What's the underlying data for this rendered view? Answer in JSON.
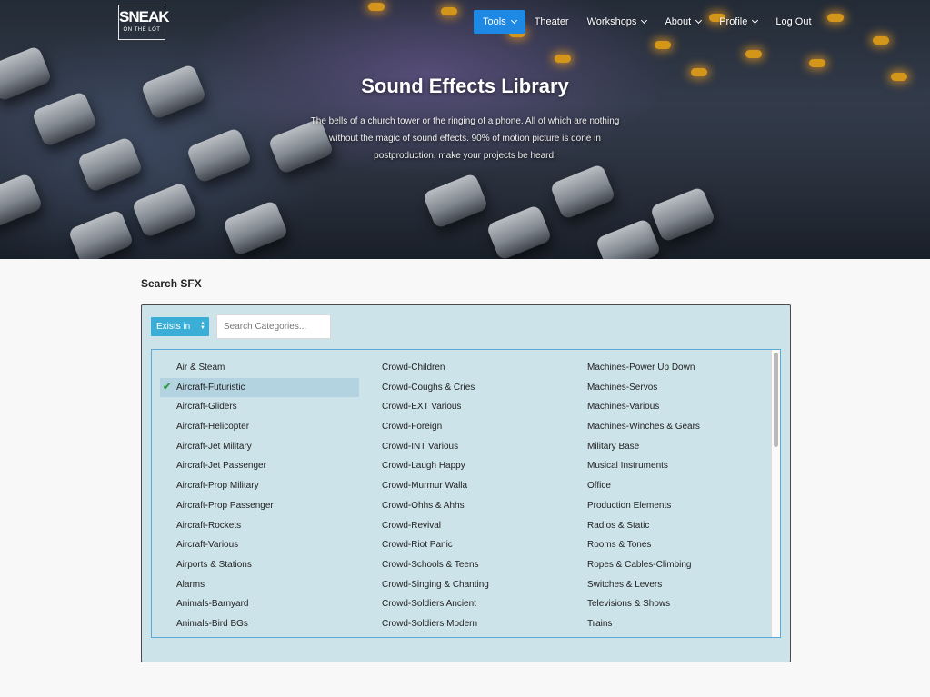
{
  "nav": {
    "logo_line1": "SNEAK",
    "logo_line2": "ON THE LOT",
    "items": [
      {
        "label": "Tools",
        "dropdown": true,
        "active": true
      },
      {
        "label": "Theater",
        "dropdown": false,
        "active": false
      },
      {
        "label": "Workshops",
        "dropdown": true,
        "active": false
      },
      {
        "label": "About",
        "dropdown": true,
        "active": false
      },
      {
        "label": "Profile",
        "dropdown": true,
        "active": false
      },
      {
        "label": "Log Out",
        "dropdown": false,
        "active": false
      }
    ]
  },
  "hero": {
    "title": "Sound Effects Library",
    "subtitle": "The bells of a church tower or the ringing of a phone. All of which are nothing without the magic of sound effects. 90% of motion picture is done in postproduction, make your projects be heard."
  },
  "search": {
    "title": "Search SFX",
    "filter_selected": "Exists in",
    "placeholder": "Search Categories..."
  },
  "categories": {
    "columns": [
      [
        "Air & Steam",
        "Aircraft-Futuristic",
        "Aircraft-Gliders",
        "Aircraft-Helicopter",
        "Aircraft-Jet Military",
        "Aircraft-Jet Passenger",
        "Aircraft-Prop Military",
        "Aircraft-Prop Passenger",
        "Aircraft-Rockets",
        "Aircraft-Various",
        "Airports & Stations",
        "Alarms",
        "Animals-Barnyard",
        "Animals-Bird BGs"
      ],
      [
        "Crowd-Children",
        "Crowd-Coughs & Cries",
        "Crowd-EXT Various",
        "Crowd-Foreign",
        "Crowd-INT Various",
        "Crowd-Laugh Happy",
        "Crowd-Murmur Walla",
        "Crowd-Ohhs & Ahhs",
        "Crowd-Revival",
        "Crowd-Riot Panic",
        "Crowd-Schools & Teens",
        "Crowd-Singing & Chanting",
        "Crowd-Soldiers Ancient",
        "Crowd-Soldiers Modern"
      ],
      [
        "Machines-Power Up Down",
        "Machines-Servos",
        "Machines-Various",
        "Machines-Winches & Gears",
        "Military Base",
        "Musical Instruments",
        "Office",
        "Production Elements",
        "Radios & Static",
        "Rooms & Tones",
        "Ropes & Cables-Climbing",
        "Switches & Levers",
        "Televisions & Shows",
        "Trains"
      ]
    ],
    "selected": "Aircraft-Futuristic"
  },
  "colors": {
    "accent": "#1e88e5",
    "select_bg": "#3aaed6",
    "panel_bg": "#cde3ea",
    "selected_row": "#b4d3e0",
    "check": "#2e9a47"
  }
}
